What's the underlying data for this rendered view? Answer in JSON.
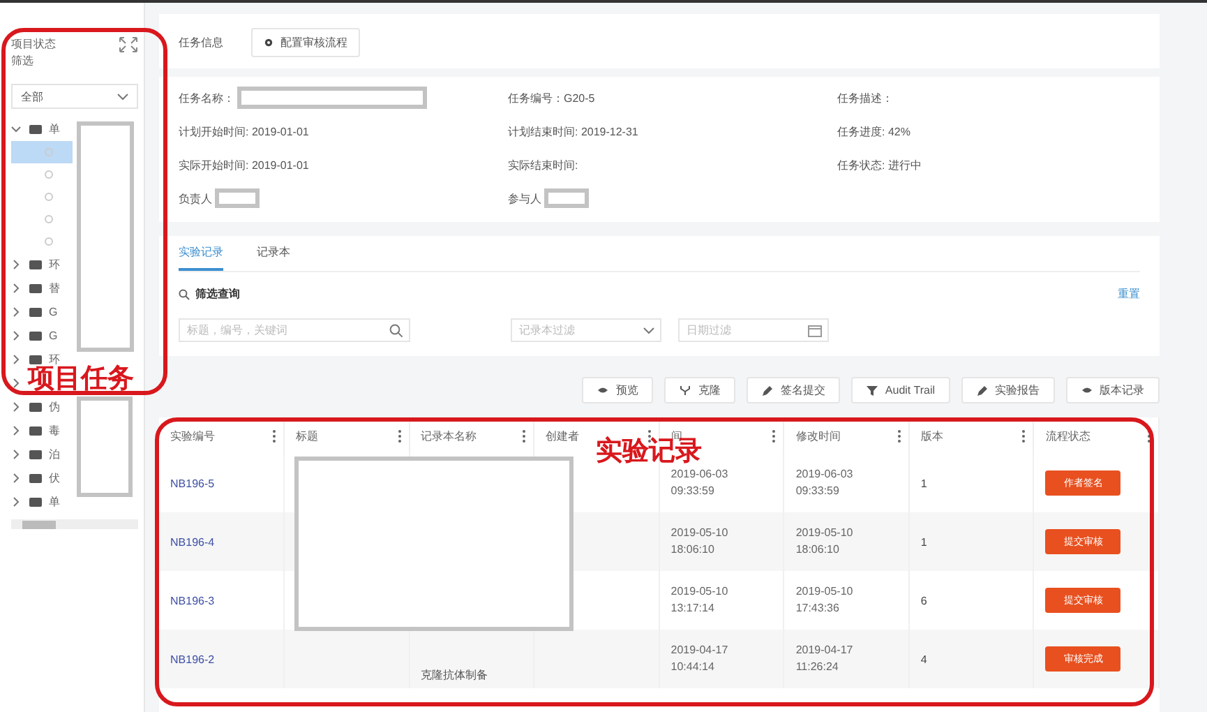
{
  "sidebar": {
    "title": "项目状态",
    "filter_label": "筛选",
    "select": {
      "value": "全部"
    },
    "tree": [
      {
        "label": "单",
        "expanded": true,
        "children": [
          {
            "selected": true
          },
          {
            "selected": false
          },
          {
            "selected": false
          },
          {
            "selected": false
          },
          {
            "selected": false
          }
        ]
      },
      {
        "label": "环",
        "expanded": false
      },
      {
        "label": "替",
        "expanded": false
      },
      {
        "label": "G",
        "expanded": false
      },
      {
        "label": "G",
        "expanded": false
      },
      {
        "label": "环",
        "expanded": false
      },
      {
        "expanded": false
      },
      {
        "label": "伪",
        "expanded": false
      },
      {
        "label": "毒",
        "expanded": false
      },
      {
        "label": "泊",
        "expanded": false
      },
      {
        "label": "伏",
        "expanded": false
      },
      {
        "label": "单",
        "expanded": false
      }
    ]
  },
  "task": {
    "title": "任务信息",
    "config_button": "配置审核流程",
    "fields": [
      {
        "label": "任务名称：",
        "redacted": true,
        "kind": "wide"
      },
      {
        "label": "任务编号：G20-5",
        "redacted": false
      },
      {
        "label": "任务描述：",
        "redacted": false
      },
      {
        "label": "计划开始时间: 2019-01-01",
        "redacted": false
      },
      {
        "label": "计划结束时间: 2019-12-31",
        "redacted": false
      },
      {
        "label": "任务进度: 42%",
        "redacted": false
      },
      {
        "label": "实际开始时间: 2019-01-01",
        "redacted": false
      },
      {
        "label": "实际结束时间:",
        "redacted": false
      },
      {
        "label": "任务状态: 进行中",
        "redacted": false
      },
      {
        "label": "负责人",
        "redacted": true,
        "kind": "short"
      },
      {
        "label": "参与人",
        "redacted": true,
        "kind": "short"
      }
    ]
  },
  "tabs": [
    {
      "label": "实验记录",
      "selected": true
    },
    {
      "label": "记录本",
      "selected": false
    }
  ],
  "filter": {
    "title": "筛选查询",
    "reset": "重置",
    "search": {
      "placeholder": "标题，编号，关键词"
    },
    "notebook": {
      "placeholder": "记录本过滤"
    },
    "date": {
      "placeholder": "日期过滤"
    }
  },
  "actions": [
    {
      "label": "预览",
      "kind": "eye"
    },
    {
      "label": "克隆",
      "kind": "fork"
    },
    {
      "label": "签名提交",
      "kind": "pen"
    },
    {
      "label": "Audit Trail",
      "kind": "filter"
    },
    {
      "label": "实验报告",
      "kind": "pen"
    },
    {
      "label": "版本记录",
      "kind": "eye"
    }
  ],
  "table": {
    "columns": [
      "实验编号",
      "标题",
      "记录本名称",
      "创建者",
      "间",
      "修改时间",
      "版本",
      "流程状态"
    ],
    "rows": [
      {
        "id": "NB196-5",
        "created": [
          "2019-06-03",
          "09:33:59"
        ],
        "modified": [
          "2019-06-03",
          "09:33:59"
        ],
        "version": "1",
        "status": "作者签名"
      },
      {
        "id": "NB196-4",
        "created": [
          "2019-05-10",
          "18:06:10"
        ],
        "modified": [
          "2019-05-10",
          "18:06:10"
        ],
        "version": "1",
        "status": "提交审核"
      },
      {
        "id": "NB196-3",
        "created": [
          "2019-05-10",
          "13:17:14"
        ],
        "modified": [
          "2019-05-10",
          "17:43:36"
        ],
        "version": "6",
        "status": "提交审核"
      },
      {
        "id": "NB196-2",
        "notebook": "克隆抗体制备",
        "created": [
          "2019-04-17",
          "10:44:14"
        ],
        "modified": [
          "2019-04-17",
          "11:26:24"
        ],
        "version": "4",
        "status": "审核完成"
      }
    ]
  },
  "annotations": [
    {
      "label": "项目任务"
    },
    {
      "label": "实验记录"
    }
  ]
}
